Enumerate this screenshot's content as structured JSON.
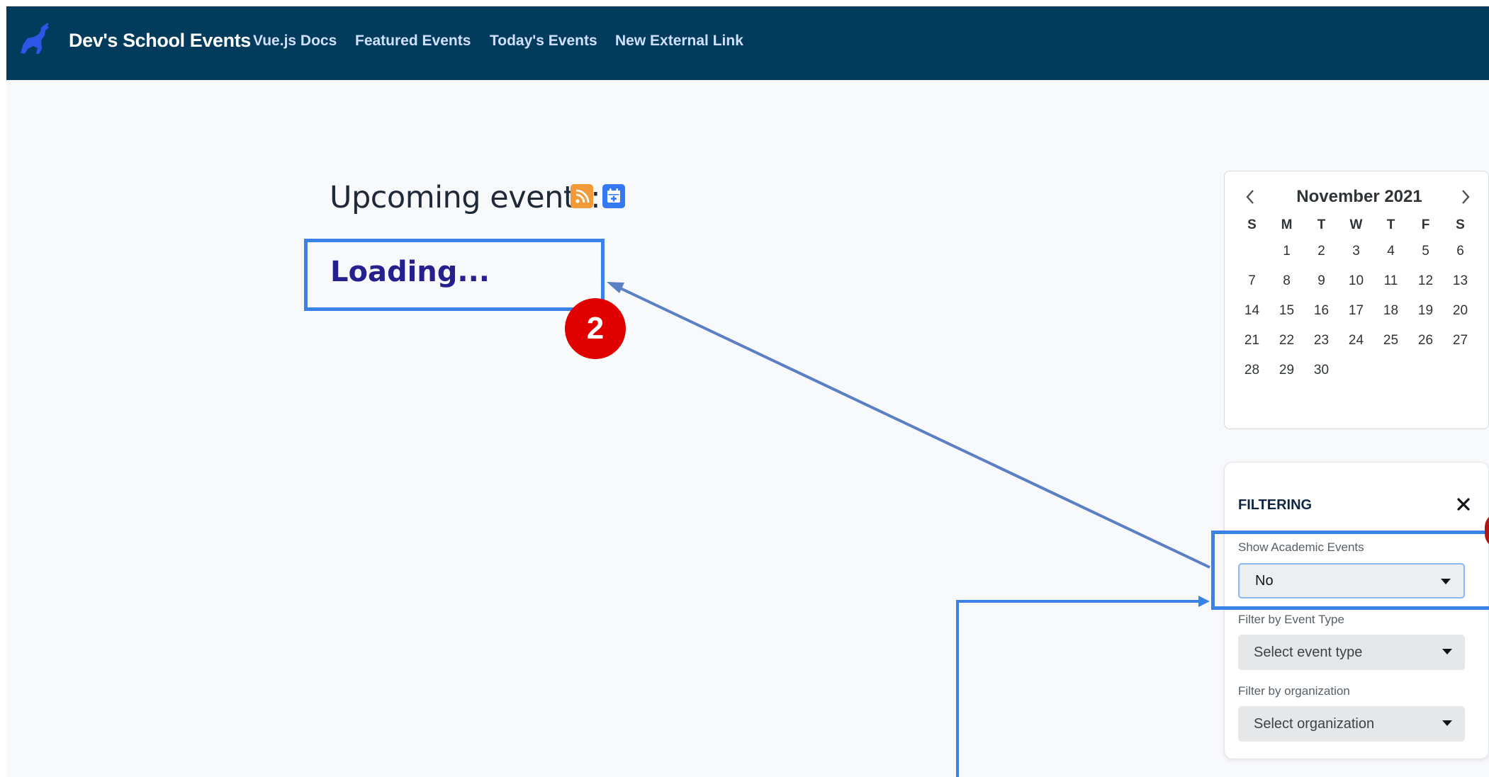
{
  "colors": {
    "navbar_bg": "#033b5c",
    "brand_text": "#ffffff",
    "nav_link": "#cfe0ff",
    "loading_text": "#26208e",
    "annotation_blue": "#3b82e6",
    "annotation_red": "#e00000",
    "rss_orange": "#f29a39",
    "calendar_blue": "#3478f6"
  },
  "navbar": {
    "logo_icon": "greyhound-logo-icon",
    "brand": "Dev's School Events",
    "links": [
      "Vue.js Docs",
      "Featured Events",
      "Today's Events",
      "New External Link"
    ]
  },
  "main": {
    "heading": "Upcoming events:",
    "rss_icon": "rss-icon",
    "calendar_icon": "calendar-add-icon",
    "loading": "Loading..."
  },
  "annotation": {
    "badge_number": "2"
  },
  "calendar": {
    "month_label": "November 2021",
    "prev_icon": "chevron-left-icon",
    "next_icon": "chevron-right-icon",
    "weekdays": [
      "S",
      "M",
      "T",
      "W",
      "T",
      "F",
      "S"
    ],
    "weeks": [
      [
        "",
        "1",
        "2",
        "3",
        "4",
        "5",
        "6"
      ],
      [
        "7",
        "8",
        "9",
        "10",
        "11",
        "12",
        "13"
      ],
      [
        "14",
        "15",
        "16",
        "17",
        "18",
        "19",
        "20"
      ],
      [
        "21",
        "22",
        "23",
        "24",
        "25",
        "26",
        "27"
      ],
      [
        "28",
        "29",
        "30",
        "",
        "",
        "",
        ""
      ]
    ]
  },
  "filtering": {
    "title": "FILTERING",
    "close_icon": "close-icon",
    "academic": {
      "label": "Show Academic Events",
      "value": "No"
    },
    "event_type": {
      "label": "Filter by Event Type",
      "placeholder": "Select event type"
    },
    "organization": {
      "label": "Filter by organization",
      "placeholder": "Select organization"
    }
  }
}
